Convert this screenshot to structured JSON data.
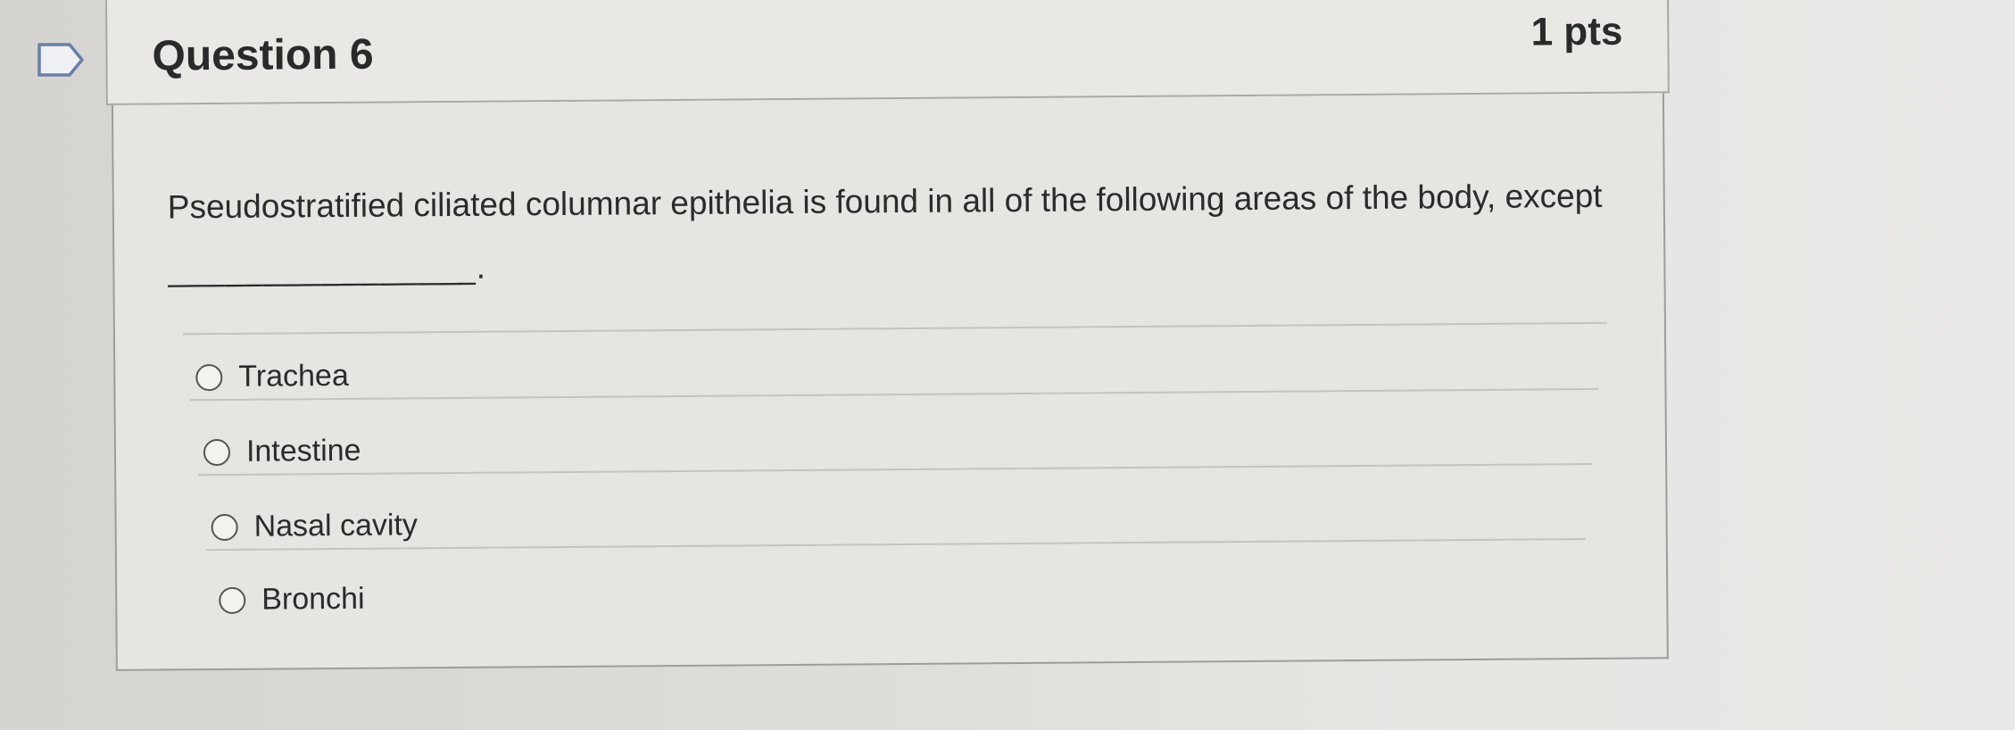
{
  "question": {
    "title": "Question 6",
    "points": "1 pts",
    "text": "Pseudostratified ciliated columnar epithelia is found in all of the following areas of the body, except",
    "blank": "________________."
  },
  "answers": [
    {
      "label": "Trachea",
      "selected": false
    },
    {
      "label": "Intestine",
      "selected": false
    },
    {
      "label": "Nasal cavity",
      "selected": false
    },
    {
      "label": "Bronchi",
      "selected": false
    }
  ],
  "icons": {
    "flag": "bookmark-flag-icon",
    "radio": "radio-button-icon"
  },
  "colors": {
    "header_bg": "#e9e8e5",
    "border": "#a9a8a5",
    "text": "#2b2b2b",
    "flag_stroke": "#6a7ea8"
  }
}
